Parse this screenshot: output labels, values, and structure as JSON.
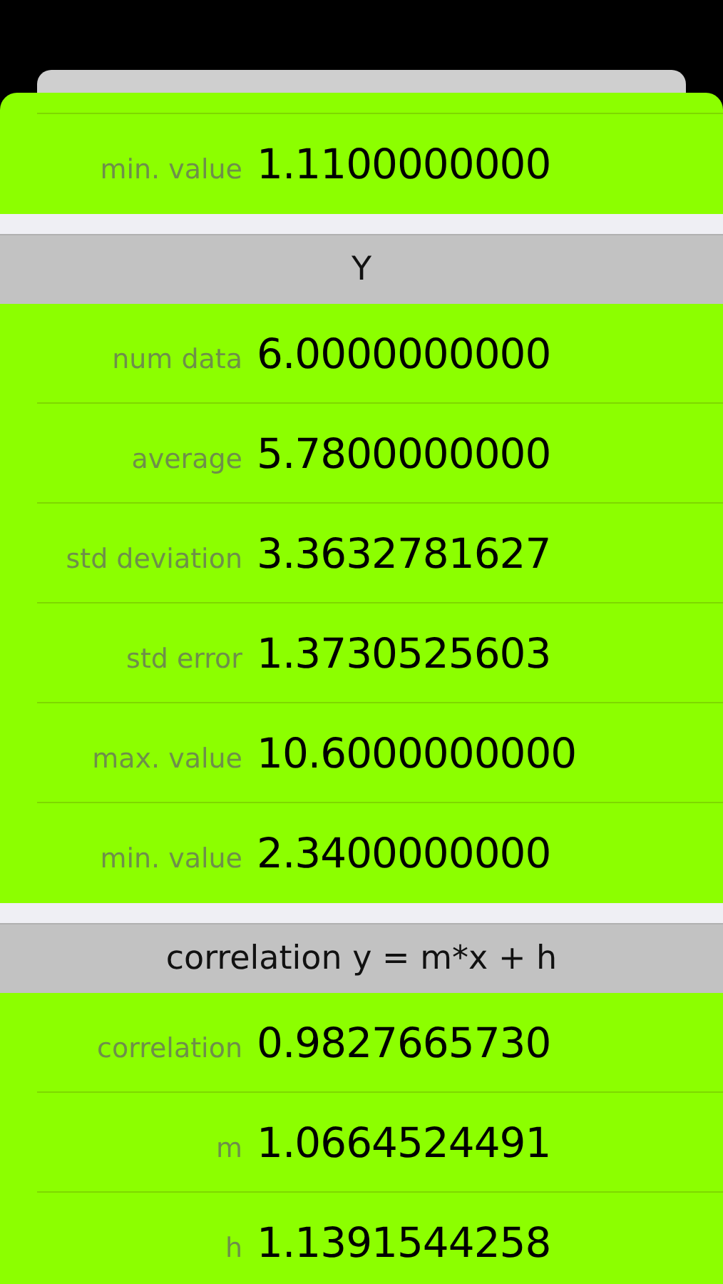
{
  "sections": [
    {
      "rows": [
        {
          "label": "min. value",
          "value": "1.1100000000"
        }
      ]
    },
    {
      "header": "Y",
      "rows": [
        {
          "label": "num data",
          "value": "6.0000000000"
        },
        {
          "label": "average",
          "value": "5.7800000000"
        },
        {
          "label": "std deviation",
          "value": "3.3632781627"
        },
        {
          "label": "std error",
          "value": "1.3730525603"
        },
        {
          "label": "max. value",
          "value": "10.6000000000"
        },
        {
          "label": "min. value",
          "value": "2.3400000000"
        }
      ]
    },
    {
      "header": "correlation y = m*x + h",
      "rows": [
        {
          "label": "correlation",
          "value": "0.9827665730"
        },
        {
          "label": "m",
          "value": "1.0664524491"
        },
        {
          "label": "h",
          "value": "1.1391544258"
        }
      ]
    }
  ]
}
